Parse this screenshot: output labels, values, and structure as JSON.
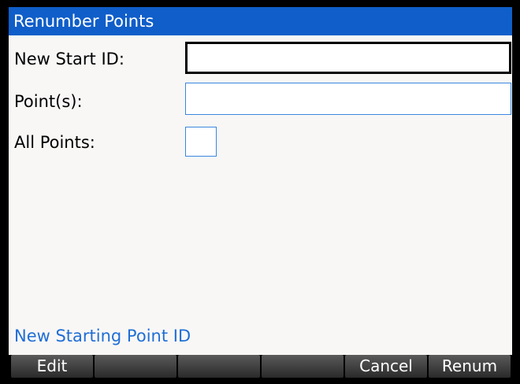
{
  "window": {
    "title": "Renumber Points"
  },
  "form": {
    "new_start_id_label": "New Start ID:",
    "new_start_id_value": "",
    "points_label": "Point(s):",
    "points_value": "",
    "all_points_label": "All Points:",
    "all_points_checked": false
  },
  "help_text": "New Starting Point ID",
  "softkeys": [
    "Edit",
    "",
    "",
    "",
    "Cancel",
    "Renum"
  ],
  "colors": {
    "title_bar": "#0f5ec9",
    "help_text": "#1f6ed6",
    "field_border": "#3a87e0",
    "softkey_bar": "#000000"
  }
}
